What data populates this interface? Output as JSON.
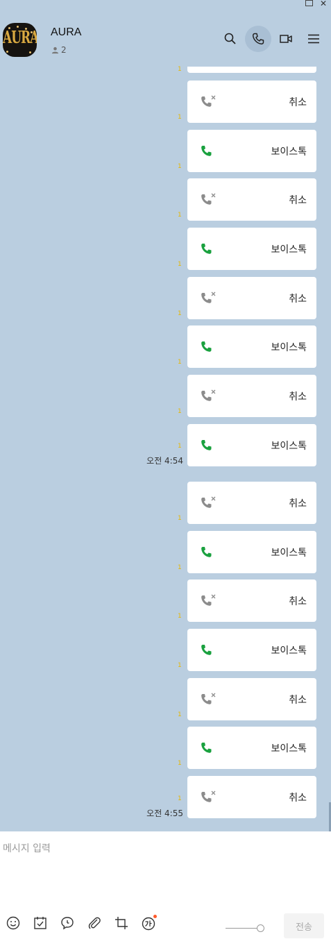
{
  "window": {
    "maximize_icon": "maximize-icon",
    "close_symbol": "✕"
  },
  "chat": {
    "title": "AURA",
    "avatar_text": "AURA",
    "member_count": "2"
  },
  "header_icons": [
    "search-icon",
    "phone-icon",
    "video-icon",
    "menu-icon"
  ],
  "messages": [
    {
      "type": "partial"
    },
    {
      "type": "cancelled",
      "label": "취소",
      "unread": "1"
    },
    {
      "type": "voice",
      "label": "보이스톡",
      "unread": "1"
    },
    {
      "type": "cancelled",
      "label": "취소",
      "unread": "1"
    },
    {
      "type": "voice",
      "label": "보이스톡",
      "unread": "1"
    },
    {
      "type": "cancelled",
      "label": "취소",
      "unread": "1"
    },
    {
      "type": "voice",
      "label": "보이스톡",
      "unread": "1"
    },
    {
      "type": "cancelled",
      "label": "취소",
      "unread": "1"
    },
    {
      "type": "voice",
      "label": "보이스톡",
      "unread": "1",
      "time": "오전 4:54"
    },
    {
      "type": "cancelled",
      "label": "취소",
      "unread": "1"
    },
    {
      "type": "voice",
      "label": "보이스톡",
      "unread": "1"
    },
    {
      "type": "cancelled",
      "label": "취소",
      "unread": "1"
    },
    {
      "type": "voice",
      "label": "보이스톡",
      "unread": "1"
    },
    {
      "type": "cancelled",
      "label": "취소",
      "unread": "1"
    },
    {
      "type": "voice",
      "label": "보이스톡",
      "unread": "1"
    },
    {
      "type": "cancelled",
      "label": "취소",
      "unread": "1",
      "time": "오전 4:55"
    }
  ],
  "composer": {
    "placeholder": "메시지 입력",
    "send_label": "전송",
    "toolbar_icons": [
      "emoticon-icon",
      "calendar-check-icon",
      "speech-bubble-icon",
      "paperclip-icon",
      "crop-icon",
      "translate-icon"
    ]
  },
  "colors": {
    "chat_background": "#bacee0",
    "voice_call_green": "#1aa13f",
    "cancelled_gray": "#8c8c8c",
    "unread_yellow": "#e6b600",
    "notify_dot": "#ff5a2b"
  }
}
